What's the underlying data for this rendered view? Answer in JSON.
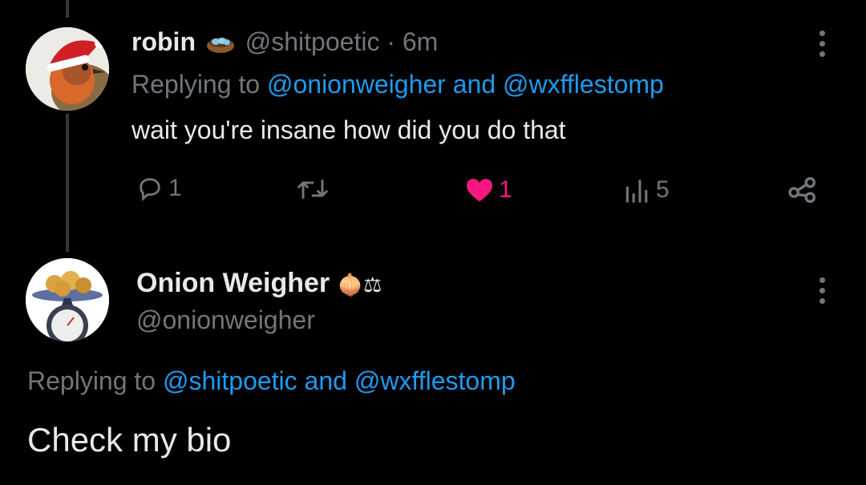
{
  "tweet1": {
    "display_name": "robin",
    "handle": "@shitpoetic",
    "separator": "·",
    "time": "6m",
    "reply_prefix": "Replying to",
    "reply_user1": "@onionweigher",
    "reply_and": "and",
    "reply_user2": "@wxfflestomp",
    "text": "wait you're insane how did you do that",
    "actions": {
      "replies": "1",
      "likes": "1",
      "views": "5"
    },
    "like_color": "#f91880"
  },
  "tweet2": {
    "display_name": "Onion Weigher",
    "name_emoji": "🧅⚖",
    "handle": "@onionweigher",
    "reply_prefix": "Replying to",
    "reply_user1": "@shitpoetic",
    "reply_and": "and",
    "reply_user2": "@wxfflestomp",
    "text": "Check my bio"
  },
  "colors": {
    "link": "#1d9bf0",
    "muted": "#71767b",
    "background": "#000000"
  }
}
